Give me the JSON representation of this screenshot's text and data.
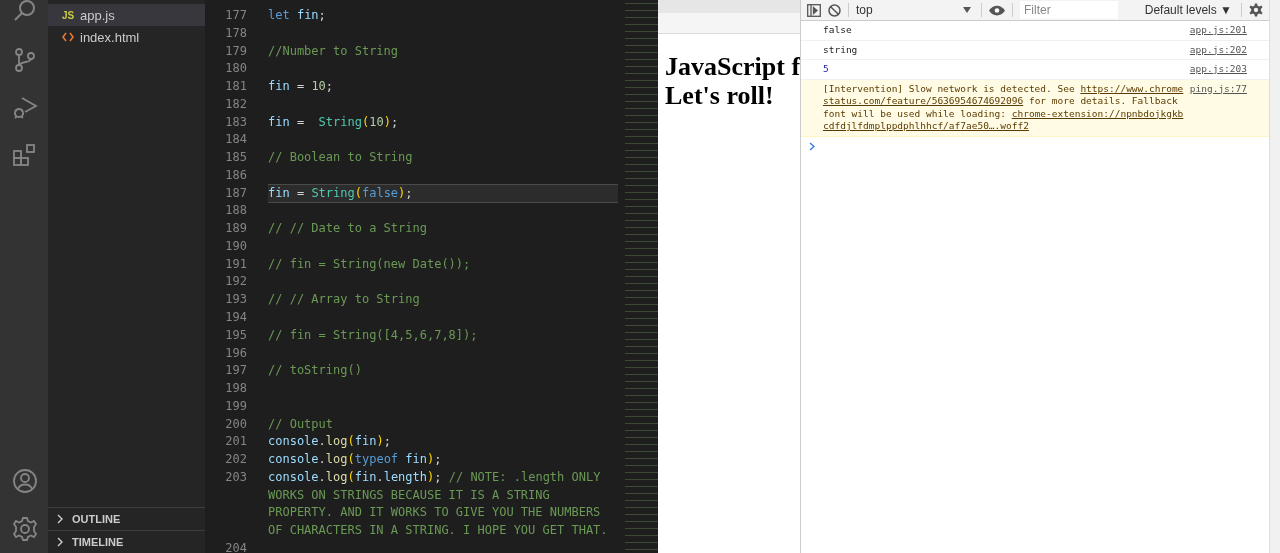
{
  "activity_bar": {
    "items": [
      {
        "kind": "search",
        "selected": false
      },
      {
        "kind": "source-control",
        "selected": false
      },
      {
        "kind": "run",
        "selected": false
      },
      {
        "kind": "extensions",
        "selected": false
      }
    ],
    "bottom": [
      {
        "kind": "account"
      },
      {
        "kind": "settings"
      }
    ]
  },
  "sidebar": {
    "files": [
      {
        "kind": "js",
        "badge": "JS",
        "name": "app.js",
        "selected": true
      },
      {
        "kind": "html",
        "name": "index.html",
        "selected": false
      }
    ],
    "sections": [
      {
        "label": "OUTLINE",
        "expanded": false
      },
      {
        "label": "TIMELINE",
        "expanded": false
      }
    ]
  },
  "editor": {
    "lines": [
      {
        "number": "177",
        "current": false,
        "tokens": [
          {
            "t": "let",
            "kind": "kw"
          },
          {
            "t": " fin",
            "kind": "var"
          },
          {
            "t": ";",
            "kind": "p"
          }
        ]
      },
      {
        "number": "178",
        "current": false
      },
      {
        "number": "179",
        "current": false,
        "tokens": [
          {
            "t": "//Number to String",
            "kind": "cm"
          }
        ]
      },
      {
        "number": "180",
        "current": false
      },
      {
        "number": "181",
        "current": false,
        "tokens": [
          {
            "t": "fin",
            "kind": "var"
          },
          {
            "t": " = ",
            "kind": "p"
          },
          {
            "t": "10",
            "kind": "num"
          },
          {
            "t": ";",
            "kind": "p"
          }
        ]
      },
      {
        "number": "182",
        "current": false
      },
      {
        "number": "183",
        "current": false,
        "tokens": [
          {
            "t": "fin",
            "kind": "var"
          },
          {
            "t": " =  ",
            "kind": "p"
          },
          {
            "t": "String",
            "kind": "type"
          },
          {
            "t": "(",
            "kind": "br"
          },
          {
            "t": "10",
            "kind": "num"
          },
          {
            "t": ")",
            "kind": "br"
          },
          {
            "t": ";",
            "kind": "p"
          }
        ]
      },
      {
        "number": "184",
        "current": false
      },
      {
        "number": "185",
        "current": false,
        "tokens": [
          {
            "t": "// Boolean to String",
            "kind": "cm"
          }
        ]
      },
      {
        "number": "186",
        "current": false
      },
      {
        "number": "187",
        "current": true,
        "tokens": [
          {
            "t": "fin",
            "kind": "var"
          },
          {
            "t": " = ",
            "kind": "p"
          },
          {
            "t": "String",
            "kind": "type"
          },
          {
            "t": "(",
            "kind": "br"
          },
          {
            "t": "false",
            "kind": "kw"
          },
          {
            "t": ")",
            "kind": "br"
          },
          {
            "t": ";",
            "kind": "p"
          }
        ]
      },
      {
        "number": "188",
        "current": false
      },
      {
        "number": "189",
        "current": false,
        "tokens": [
          {
            "t": "// // Date to a String",
            "kind": "cm"
          }
        ]
      },
      {
        "number": "190",
        "current": false
      },
      {
        "number": "191",
        "current": false,
        "tokens": [
          {
            "t": "// fin = String(new Date());",
            "kind": "cm"
          }
        ]
      },
      {
        "number": "192",
        "current": false
      },
      {
        "number": "193",
        "current": false,
        "tokens": [
          {
            "t": "// // Array to String",
            "kind": "cm"
          }
        ]
      },
      {
        "number": "194",
        "current": false
      },
      {
        "number": "195",
        "current": false,
        "tokens": [
          {
            "t": "// fin = String([4,5,6,7,8]);",
            "kind": "cm"
          }
        ]
      },
      {
        "number": "196",
        "current": false
      },
      {
        "number": "197",
        "current": false,
        "tokens": [
          {
            "t": "// toString()",
            "kind": "cm"
          }
        ]
      },
      {
        "number": "198",
        "current": false
      },
      {
        "number": "199",
        "current": false
      },
      {
        "number": "200",
        "current": false,
        "tokens": [
          {
            "t": "// Output",
            "kind": "cm"
          }
        ]
      },
      {
        "number": "201",
        "current": false,
        "tokens": [
          {
            "t": "console",
            "kind": "var"
          },
          {
            "t": ".",
            "kind": "p"
          },
          {
            "t": "log",
            "kind": "fn"
          },
          {
            "t": "(",
            "kind": "br"
          },
          {
            "t": "fin",
            "kind": "var"
          },
          {
            "t": ")",
            "kind": "br"
          },
          {
            "t": ";",
            "kind": "p"
          }
        ]
      },
      {
        "number": "202",
        "current": false,
        "tokens": [
          {
            "t": "console",
            "kind": "var"
          },
          {
            "t": ".",
            "kind": "p"
          },
          {
            "t": "log",
            "kind": "fn"
          },
          {
            "t": "(",
            "kind": "br"
          },
          {
            "t": "typeof",
            "kind": "kw"
          },
          {
            "t": " fin",
            "kind": "var"
          },
          {
            "t": ")",
            "kind": "br"
          },
          {
            "t": ";",
            "kind": "p"
          }
        ]
      },
      {
        "number": "203",
        "current": false,
        "tokens": [
          {
            "t": "console",
            "kind": "var"
          },
          {
            "t": ".",
            "kind": "p"
          },
          {
            "t": "log",
            "kind": "fn"
          },
          {
            "t": "(",
            "kind": "br"
          },
          {
            "t": "fin",
            "kind": "var"
          },
          {
            "t": ".",
            "kind": "p"
          },
          {
            "t": "length",
            "kind": "var"
          },
          {
            "t": ")",
            "kind": "br"
          },
          {
            "t": ";",
            "kind": "p"
          },
          {
            "t": " // NOTE: .length ONLY WORKS ON STRINGS BECAUSE IT IS A STRING PROPERTY. AND IT WORKS TO GIVE YOU THE NUMBERS OF CHARACTERS IN A STRING. I HOPE YOU GET THAT.",
            "kind": "cm"
          }
        ]
      },
      {
        "number": "204",
        "current": false
      }
    ]
  },
  "page": {
    "heading_lines": [
      "JavaScript f",
      "Let's roll!"
    ]
  },
  "devtools": {
    "context": "top",
    "filter": {
      "placeholder": "Filter"
    },
    "levels": "Default levels ▼",
    "messages": [
      {
        "kind": "log",
        "segments": [
          {
            "text": "false",
            "kind": "text"
          }
        ],
        "source": "app.js:201"
      },
      {
        "kind": "log",
        "segments": [
          {
            "text": "string",
            "kind": "text"
          }
        ],
        "source": "app.js:202"
      },
      {
        "kind": "number",
        "segments": [
          {
            "text": "5",
            "kind": "text"
          }
        ],
        "source": "app.js:203"
      },
      {
        "kind": "warning",
        "segments": [
          {
            "text": "[Intervention] Slow network is detected. See ",
            "kind": "text"
          },
          {
            "text": "https://www.chromestatus.com/feature/5636954674692096",
            "kind": "link"
          },
          {
            "text": " for more details. Fallback font will be used while loading: ",
            "kind": "text"
          },
          {
            "text": "chrome-extension://npnbdojkgkbcdfdjlfdmplppdphlhhcf/af7ae50….woff2",
            "kind": "link"
          }
        ],
        "source": "ping.js:77"
      }
    ]
  }
}
